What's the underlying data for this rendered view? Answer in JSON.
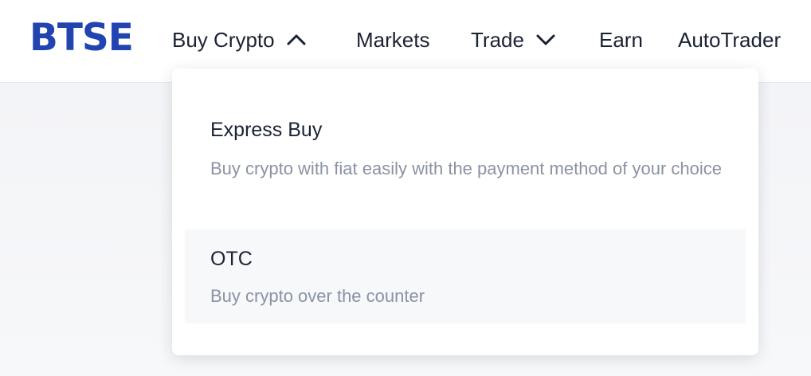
{
  "brand": {
    "logo_text": "BTSE",
    "color": "#2144b0"
  },
  "nav": {
    "buy_crypto": "Buy Crypto",
    "markets": "Markets",
    "trade": "Trade",
    "earn": "Earn",
    "autotrader": "AutoTrader",
    "buy_crypto_icon": "chevron-up-icon",
    "trade_icon": "chevron-down-icon"
  },
  "dropdown": {
    "items": [
      {
        "title": "Express Buy",
        "description": "Buy crypto with fiat easily with the payment method of your choice"
      },
      {
        "title": "OTC",
        "description": "Buy crypto over the counter",
        "highlighted": true
      }
    ]
  },
  "colors": {
    "text_primary": "#1b2233",
    "text_secondary": "#8a93a3",
    "hover_bg": "#f7f8fa"
  }
}
